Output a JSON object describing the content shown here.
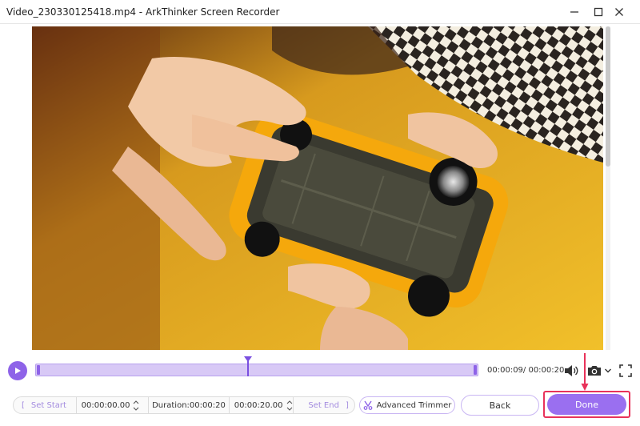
{
  "window": {
    "title": "Video_230330125418.mp4  -  ArkThinker Screen Recorder"
  },
  "icons": {
    "minimize": "minimize-icon",
    "maximize": "maximize-icon",
    "close": "close-icon",
    "play": "play-icon",
    "volume": "speaker-icon",
    "snapshot": "camera-icon",
    "fullscreen": "fullscreen-icon",
    "advanced_trimmer": "trimmer-icon"
  },
  "colors": {
    "accent": "#8e63e8",
    "track": "#d8c9f6",
    "done": "#9a6ff0",
    "highlight": "#e8325a"
  },
  "timeline": {
    "progress": 0.48,
    "readout": "00:00:09/ 00:00:20"
  },
  "trim": {
    "set_start_label": "Set Start",
    "start_time": "00:00:00.00",
    "duration": "Duration:00:00:20",
    "end_time": "00:00:20.00",
    "set_end_label": "Set End",
    "left_bracket": "[",
    "right_bracket": "]"
  },
  "buttons": {
    "advanced_trimmer": "Advanced Trimmer",
    "back": "Back",
    "done": "Done"
  }
}
